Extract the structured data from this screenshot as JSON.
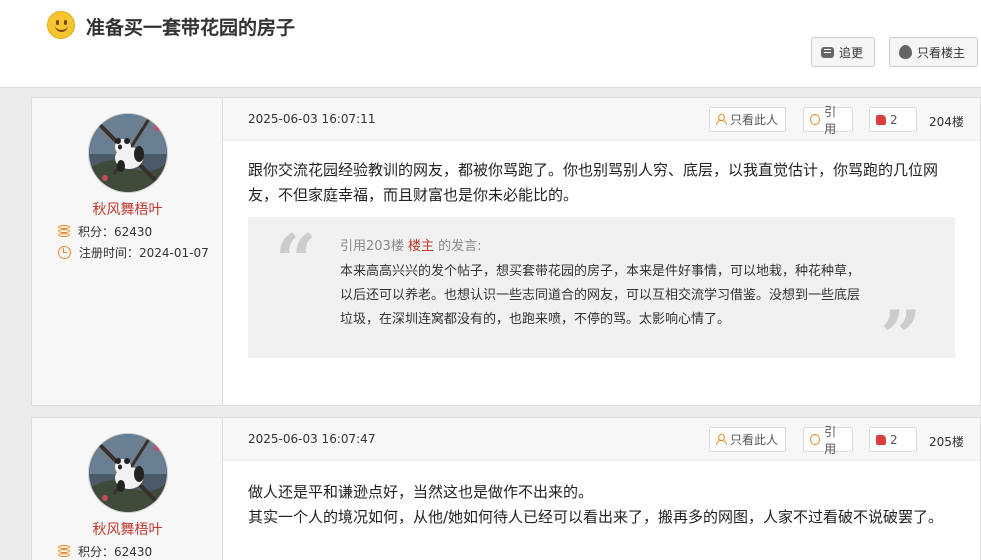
{
  "thread": {
    "title": "准备买一套带花园的房子",
    "reply_label": "追更",
    "only_owner_label": "只看楼主"
  },
  "posts": [
    {
      "username": "秋风舞梧叶",
      "points_label": "积分：",
      "points": "62430",
      "reg_label": "注册时间：",
      "reg_date": "2024-01-07",
      "date": "2025-06-03 16:07:11",
      "only_this_label": "只看此人",
      "quote_label": "引用",
      "likes": "2",
      "floor": "204楼",
      "text": "跟你交流花园经验教训的网友，都被你骂跑了。你也别骂别人穷、底层，以我直觉估计，你骂跑的几位网友，不但家庭幸福，而且财富也是你未必能比的。",
      "quote": {
        "prefix": "引用203楼",
        "author": "楼主",
        "suffix": "的发言:",
        "text": "本来高高兴兴的发个帖子，想买套带花园的房子，本来是件好事情，可以地栽，种花种草，以后还可以养老。也想认识一些志同道合的网友，可以互相交流学习借鉴。没想到一些底层垃圾，在深圳连窝都没有的，也跑来喷，不停的骂。太影响心情了。"
      }
    },
    {
      "username": "秋风舞梧叶",
      "points_label": "积分：",
      "points": "62430",
      "date": "2025-06-03 16:07:47",
      "only_this_label": "只看此人",
      "quote_label": "引用",
      "likes": "2",
      "floor": "205楼",
      "text_line1": "做人还是平和谦逊点好，当然这也是做作不出来的。",
      "text_line2": "其实一个人的境况如何，从他/她如何待人已经可以看出来了，搬再多的网图，人家不过看破不说破罢了。"
    }
  ],
  "colors": {
    "username": "#c0392b",
    "icon_accent": "#e58a2b",
    "like": "#d9403a"
  }
}
